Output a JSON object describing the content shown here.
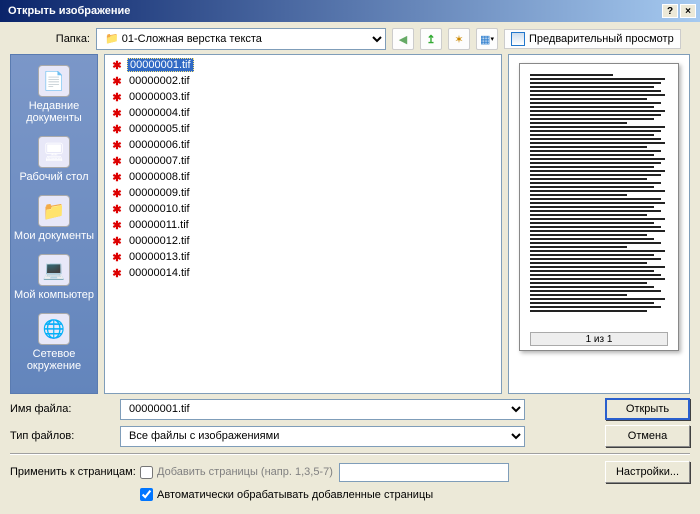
{
  "titlebar": {
    "title": "Открыть изображение",
    "help": "?",
    "close": "×"
  },
  "toprow": {
    "folder_label": "Папка:",
    "folder_value": "01-Сложная верстка текста",
    "preview_label": "Предварительный просмотр"
  },
  "sidebar": {
    "items": [
      {
        "label": "Недавние документы"
      },
      {
        "label": "Рабочий стол"
      },
      {
        "label": "Мои документы"
      },
      {
        "label": "Мой компьютер"
      },
      {
        "label": "Сетевое окружение"
      }
    ]
  },
  "files": [
    "00000001.tif",
    "00000002.tif",
    "00000003.tif",
    "00000004.tif",
    "00000005.tif",
    "00000006.tif",
    "00000007.tif",
    "00000008.tif",
    "00000009.tif",
    "00000010.tif",
    "00000011.tif",
    "00000012.tif",
    "00000013.tif",
    "00000014.tif"
  ],
  "preview": {
    "pager": "1 из 1"
  },
  "bottom": {
    "filename_label": "Имя файла:",
    "filename_value": "00000001.tif",
    "filetype_label": "Тип файлов:",
    "filetype_value": "Все файлы с изображениями",
    "open_label": "Открыть",
    "cancel_label": "Отмена",
    "settings_label": "Настройки...",
    "apply_label": "Применить к страницам:",
    "apply_placeholder": "Добавить страницы (напр. 1,3,5-7)",
    "auto_label": "Автоматически обрабатывать добавленные страницы"
  }
}
